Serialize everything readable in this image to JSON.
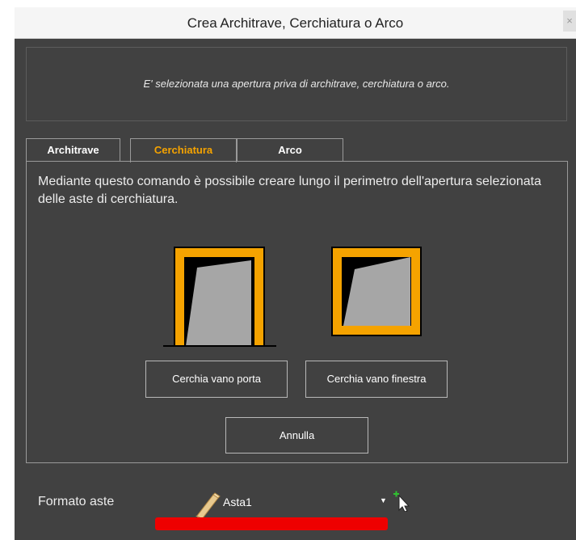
{
  "window": {
    "title": "Crea Architrave, Cerchiatura o Arco",
    "close_glyph": "×"
  },
  "message": "E' selezionata una apertura priva di architrave, cerchiatura o arco.",
  "tabs": [
    {
      "label": "Architrave",
      "active": false
    },
    {
      "label": "Cerchiatura",
      "active": true
    },
    {
      "label": "Arco",
      "active": false
    }
  ],
  "panel": {
    "description": "Mediante questo comando è possibile creare lungo il perimetro dell'apertura selezionata delle aste di cerchiatura.",
    "door_button": "Cerchia vano porta",
    "window_button": "Cerchia vano finestra",
    "cancel_button": "Annulla"
  },
  "footer": {
    "label": "Formato aste",
    "selected_value": "Asta1",
    "icon": "beam-icon",
    "dropdown_icon": "chevron-down-icon",
    "pick_icon": "pick-cursor-icon"
  },
  "colors": {
    "background": "#414141",
    "accent": "#f5a300",
    "frame_fill": "#f5a300",
    "opening_fill": "#a6a6a6",
    "highlight": "#ee0000"
  }
}
